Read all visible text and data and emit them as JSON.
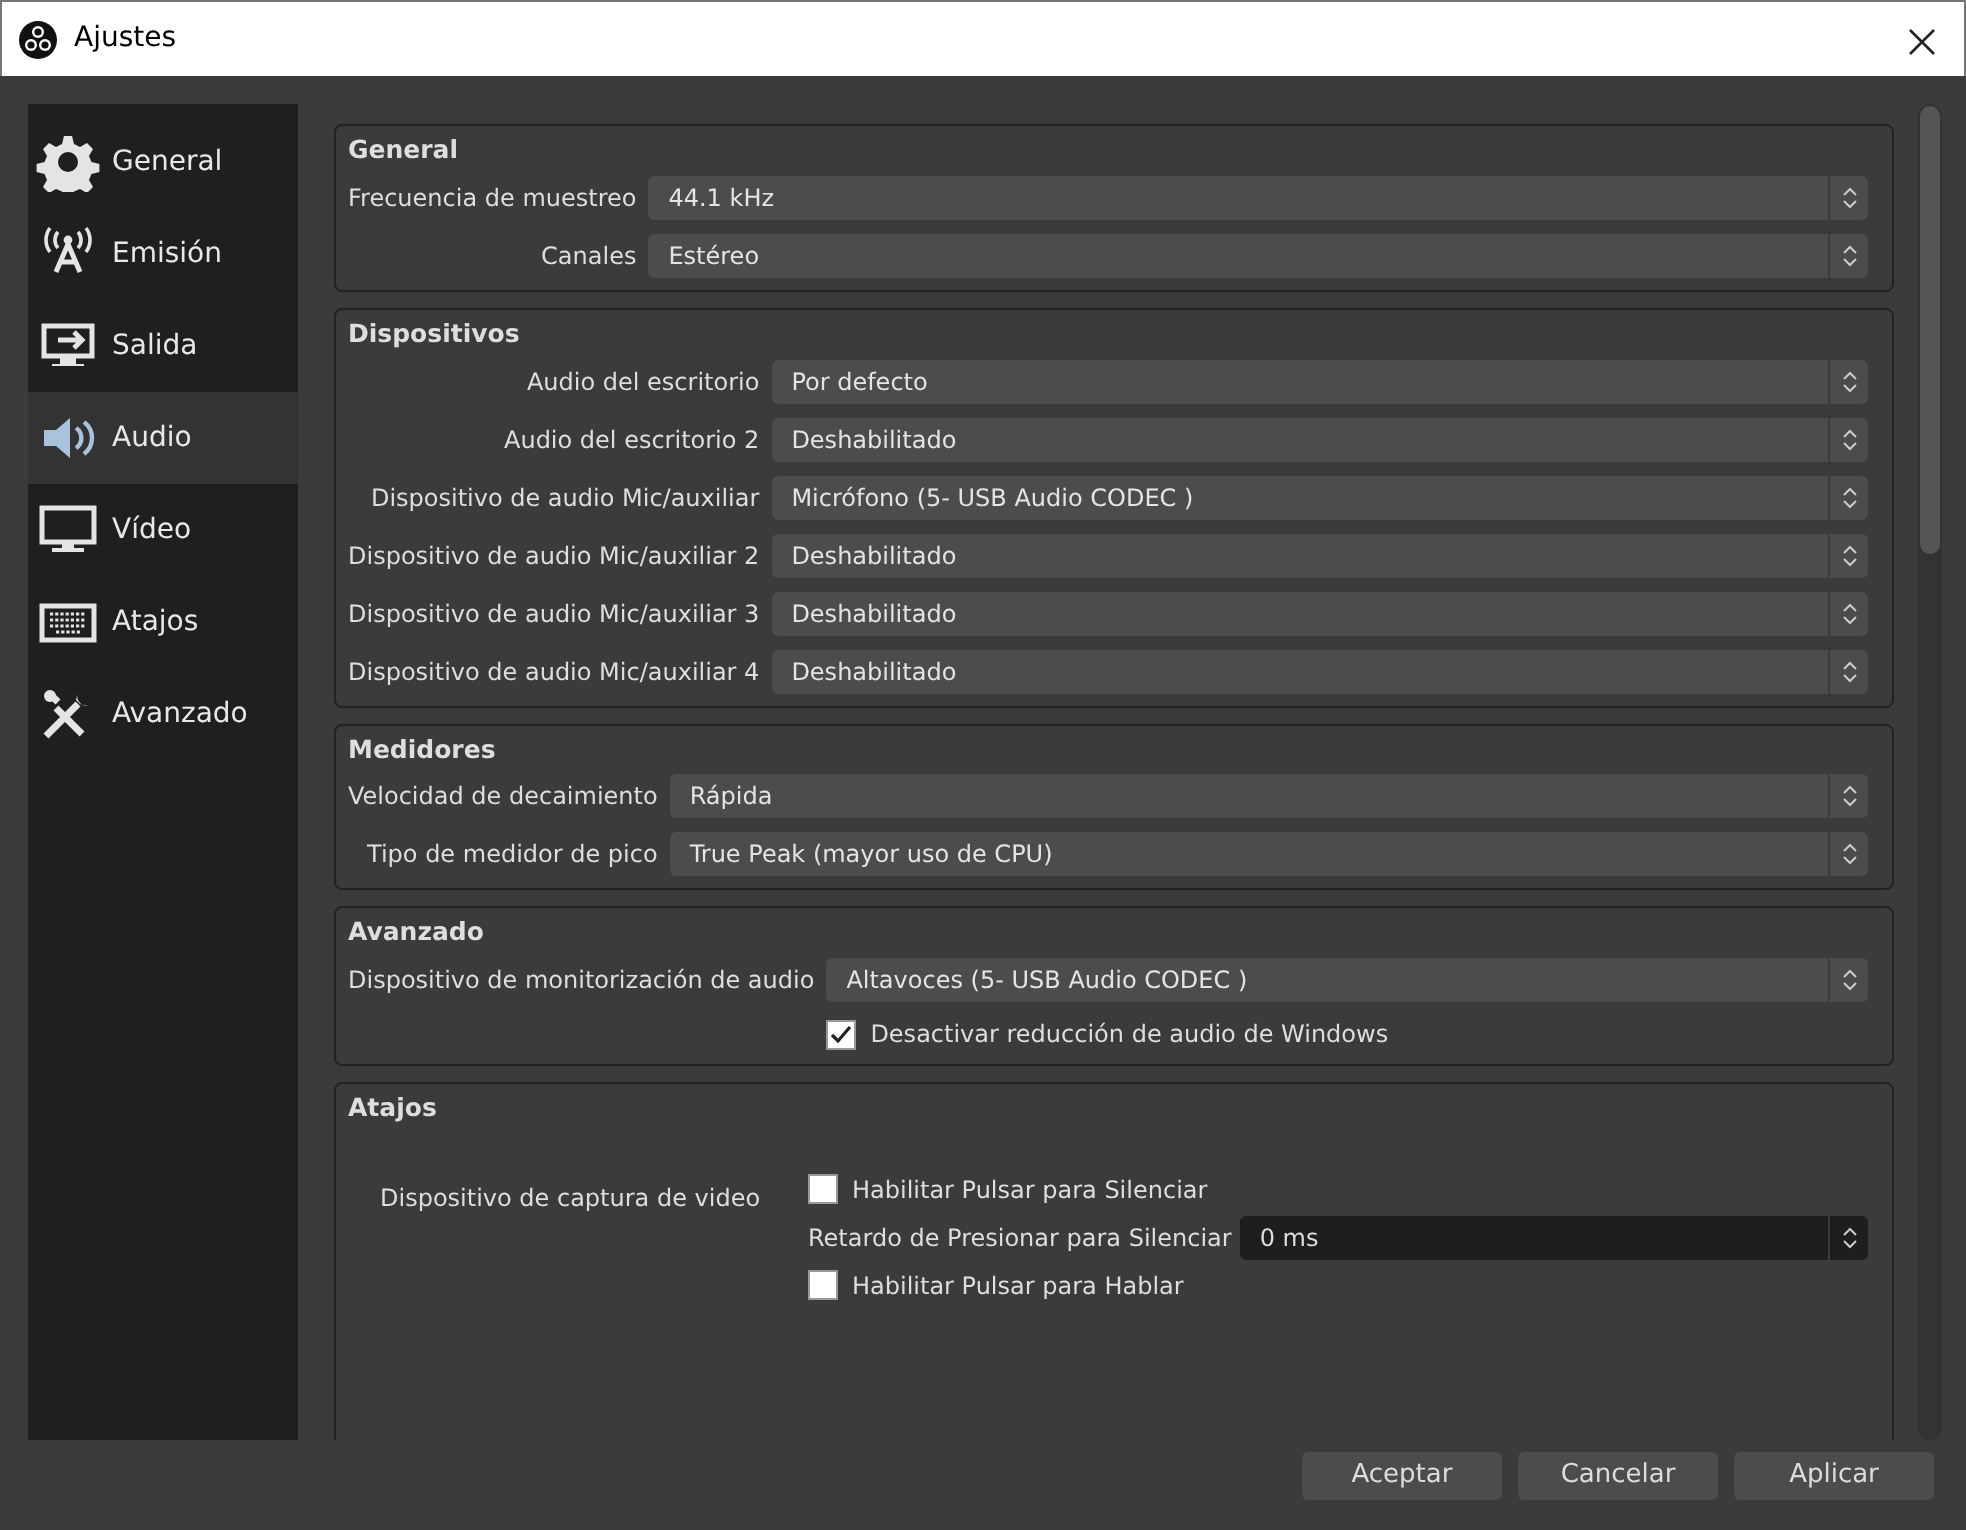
{
  "window": {
    "title": "Ajustes"
  },
  "sidebar": {
    "items": [
      {
        "label": "General",
        "selected": false
      },
      {
        "label": "Emisión",
        "selected": false
      },
      {
        "label": "Salida",
        "selected": false
      },
      {
        "label": "Audio",
        "selected": true
      },
      {
        "label": "Vídeo",
        "selected": false
      },
      {
        "label": "Atajos",
        "selected": false
      },
      {
        "label": "Avanzado",
        "selected": false
      }
    ]
  },
  "groups": [
    {
      "title": "General",
      "rows": [
        {
          "kind": "select",
          "label": "Frecuencia de muestreo",
          "value": "44.1 kHz"
        },
        {
          "kind": "select",
          "label": "Canales",
          "value": "Estéreo"
        }
      ]
    },
    {
      "title": "Dispositivos",
      "rows": [
        {
          "kind": "select",
          "label": "Audio del escritorio",
          "value": "Por defecto"
        },
        {
          "kind": "select",
          "label": "Audio del escritorio 2",
          "value": "Deshabilitado"
        },
        {
          "kind": "select",
          "label": "Dispositivo de audio Mic/auxiliar",
          "value": "Micrófono (5- USB Audio CODEC )"
        },
        {
          "kind": "select",
          "label": "Dispositivo de audio Mic/auxiliar 2",
          "value": "Deshabilitado"
        },
        {
          "kind": "select",
          "label": "Dispositivo de audio Mic/auxiliar 3",
          "value": "Deshabilitado"
        },
        {
          "kind": "select",
          "label": "Dispositivo de audio Mic/auxiliar 4",
          "value": "Deshabilitado"
        }
      ]
    },
    {
      "title": "Medidores",
      "rows": [
        {
          "kind": "select",
          "label": "Velocidad de decaimiento",
          "value": "Rápida"
        },
        {
          "kind": "select",
          "label": "Tipo de medidor de pico",
          "value": "True Peak (mayor uso de CPU)"
        }
      ]
    },
    {
      "title": "Avanzado",
      "rows": [
        {
          "kind": "select",
          "label": "Dispositivo de monitorización de audio",
          "value": "Altavoces (5- USB Audio CODEC )"
        },
        {
          "kind": "checkbox",
          "text": "Desactivar reducción de audio de Windows",
          "checked": true
        }
      ]
    }
  ],
  "hotkeys": {
    "title": "Atajos",
    "source": "Dispositivo de captura de video",
    "items": [
      {
        "kind": "checkbox",
        "text": "Habilitar Pulsar para Silenciar",
        "checked": false
      },
      {
        "kind": "spin",
        "label": "Retardo de Presionar para Silenciar",
        "value": "0 ms"
      },
      {
        "kind": "checkbox",
        "text": "Habilitar Pulsar para Hablar",
        "checked": false
      }
    ]
  },
  "buttons": [
    "Aceptar",
    "Cancelar",
    "Aplicar"
  ]
}
